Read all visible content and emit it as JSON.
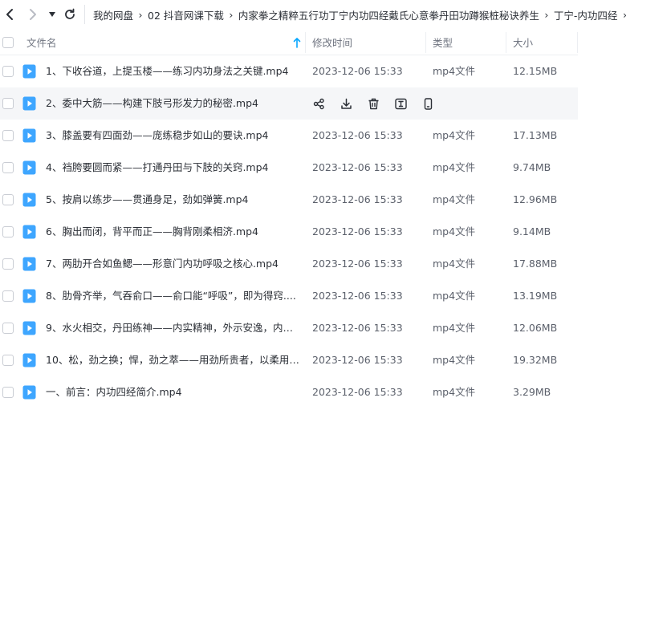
{
  "nav": {
    "back_icon": "chevron-left-icon",
    "forward_icon": "chevron-right-icon",
    "history_icon": "caret-down-icon",
    "refresh_icon": "refresh-icon"
  },
  "breadcrumb": [
    {
      "label": "我的网盘"
    },
    {
      "label": "02 抖音网课下载"
    },
    {
      "label": "内家拳之精粹五行功丁宁内功四经戴氏心意拳丹田功蹲猴桩秘诀养生"
    },
    {
      "label": "丁宁-内功四经"
    }
  ],
  "columns": {
    "name": "文件名",
    "modified": "修改时间",
    "type": "类型",
    "size": "大小"
  },
  "hover_actions": [
    "share-icon",
    "download-icon",
    "delete-icon",
    "rename-icon",
    "send-to-phone-icon"
  ],
  "files": [
    {
      "name": "1、下收谷道，上提玉楼——练习内功身法之关键.mp4",
      "modified": "2023-12-06 15:33",
      "type": "mp4文件",
      "size": "12.15MB"
    },
    {
      "name": "2、委中大筋——构建下肢弓形发力的秘密.mp4",
      "modified": "",
      "type": "",
      "size": "",
      "hover": true
    },
    {
      "name": "3、膝盖要有四面劲——庞练稳步如山的要诀.mp4",
      "modified": "2023-12-06 15:33",
      "type": "mp4文件",
      "size": "17.13MB"
    },
    {
      "name": "4、裆胯要圆而紧——打通丹田与下肢的关窍.mp4",
      "modified": "2023-12-06 15:33",
      "type": "mp4文件",
      "size": "9.74MB"
    },
    {
      "name": "5、按肩以练步——贯通身足，劲如弹簧.mp4",
      "modified": "2023-12-06 15:33",
      "type": "mp4文件",
      "size": "12.96MB"
    },
    {
      "name": "6、胸出而闭，背平而正——胸背刚柔相济.mp4",
      "modified": "2023-12-06 15:33",
      "type": "mp4文件",
      "size": "9.14MB"
    },
    {
      "name": "7、两肋开合如鱼鳃——形意门内功呼吸之核心.mp4",
      "modified": "2023-12-06 15:33",
      "type": "mp4文件",
      "size": "17.88MB"
    },
    {
      "name": "8、肋骨齐举，气吞俞口——俞口能“呼吸”，即为得窍....",
      "modified": "2023-12-06 15:33",
      "type": "mp4文件",
      "size": "13.19MB"
    },
    {
      "name": "9、水火相交，丹田练神——内实精神，外示安逸，内家...",
      "modified": "2023-12-06 15:33",
      "type": "mp4文件",
      "size": "12.06MB"
    },
    {
      "name": "10、松，劲之换；悍，劲之萃——用劲所贵者，以柔用刚...",
      "modified": "2023-12-06 15:33",
      "type": "mp4文件",
      "size": "19.32MB"
    },
    {
      "name": "一、前言：内功四经简介.mp4",
      "modified": "2023-12-06 15:33",
      "type": "mp4文件",
      "size": "3.29MB"
    }
  ],
  "colors": {
    "accent": "#06a7ff",
    "file_icon": "#3ea6ff",
    "hover_row": "#f5f6f8"
  }
}
